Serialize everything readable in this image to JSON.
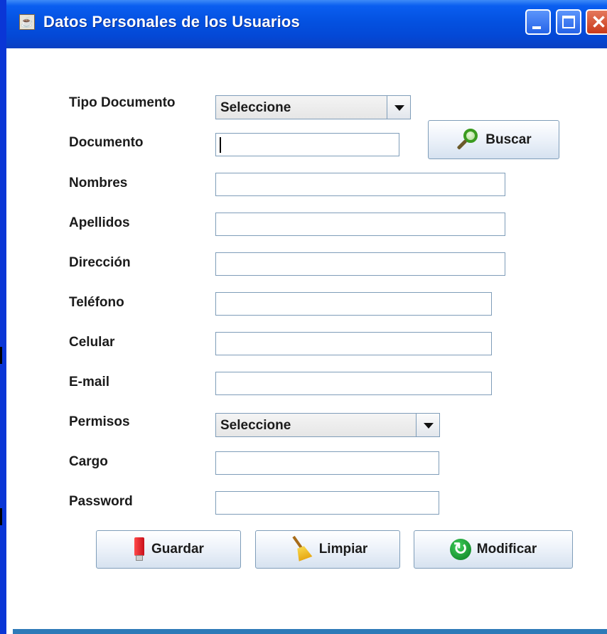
{
  "window": {
    "title": "Datos Personales de los Usuarios",
    "icon": "java-cup-icon",
    "controls": [
      "minimize-icon",
      "maximize-icon",
      "close-icon"
    ]
  },
  "form": {
    "tipo_documento": {
      "label": "Tipo Documento",
      "selected": "Seleccione"
    },
    "documento": {
      "label": "Documento",
      "value": ""
    },
    "buscar_label": "Buscar",
    "nombres": {
      "label": "Nombres",
      "value": ""
    },
    "apellidos": {
      "label": "Apellidos",
      "value": ""
    },
    "direccion": {
      "label": "Dirección",
      "value": ""
    },
    "telefono": {
      "label": "Teléfono",
      "value": ""
    },
    "celular": {
      "label": "Celular",
      "value": ""
    },
    "email": {
      "label": "E-mail",
      "value": ""
    },
    "permisos": {
      "label": "Permisos",
      "selected": "Seleccione"
    },
    "cargo": {
      "label": "Cargo",
      "value": ""
    },
    "password": {
      "label": "Password",
      "value": ""
    }
  },
  "actions": {
    "guardar": {
      "label": "Guardar",
      "icon": "usb-drive-icon"
    },
    "limpiar": {
      "label": "Limpiar",
      "icon": "broom-icon"
    },
    "modificar": {
      "label": "Modificar",
      "icon": "refresh-icon"
    },
    "buscar_icon": "magnifier-icon"
  },
  "colors": {
    "titlebar": "#0451e0",
    "frame_border": "#0a36d6",
    "field_border": "#7f9db9"
  }
}
